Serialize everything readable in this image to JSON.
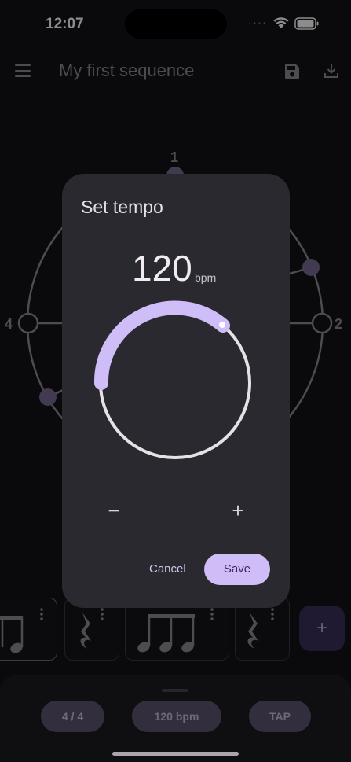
{
  "status_bar": {
    "time": "12:07",
    "signal": "····"
  },
  "app_bar": {
    "title": "My first sequence",
    "menu_icon": "menu-icon",
    "save_icon": "save-icon",
    "download_icon": "download-icon"
  },
  "beat_circle": {
    "labels": [
      "1",
      "2",
      "4"
    ]
  },
  "pattern_strip": {
    "add_label": "+"
  },
  "bottom_bar": {
    "time_signature": "4 / 4",
    "tempo": "120 bpm",
    "tap": "TAP"
  },
  "dialog": {
    "title": "Set tempo",
    "tempo_value": "120",
    "tempo_unit": "bpm",
    "decrement": "−",
    "increment": "+",
    "cancel": "Cancel",
    "save": "Save"
  },
  "colors": {
    "accent": "#cfbdf7",
    "surface": "#2b2930",
    "background": "#131215",
    "pill": "#5d5470"
  }
}
